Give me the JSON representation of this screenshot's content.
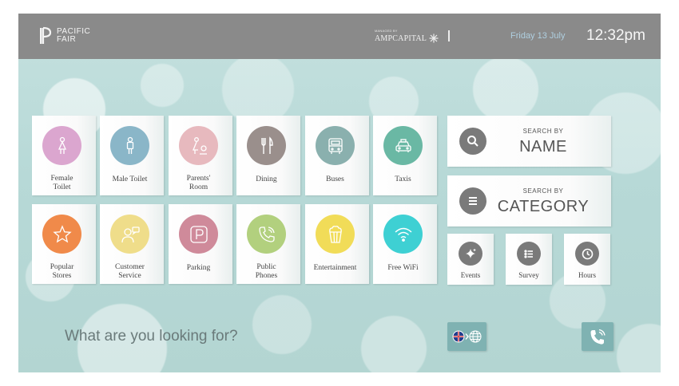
{
  "header": {
    "logo_line1": "PACIFIC",
    "logo_line2": "FAIR",
    "partner_small": "MANAGED BY",
    "partner_name": "AMPCAPITAL",
    "date": "Friday 13 July",
    "time": "12:32pm"
  },
  "tiles": [
    {
      "label": "Female\nToilet",
      "color": "#dba6cf",
      "icon": "female-icon"
    },
    {
      "label": "Male Toilet",
      "color": "#8ab6c8",
      "icon": "male-icon"
    },
    {
      "label": "Parents'\nRoom",
      "color": "#e7b9be",
      "icon": "parents-room-icon"
    },
    {
      "label": "Dining",
      "color": "#9a8f8c",
      "icon": "dining-icon"
    },
    {
      "label": "Buses",
      "color": "#8ab0ae",
      "icon": "bus-icon"
    },
    {
      "label": "Taxis",
      "color": "#6ab8a4",
      "icon": "taxi-icon"
    },
    {
      "label": "Popular\nStores",
      "color": "#f08a4a",
      "icon": "star-icon"
    },
    {
      "label": "Customer\nService",
      "color": "#efdd8a",
      "icon": "customer-service-icon"
    },
    {
      "label": "Parking",
      "color": "#cf8a9a",
      "icon": "parking-icon"
    },
    {
      "label": "Public\nPhones",
      "color": "#b2d07e",
      "icon": "phone-icon"
    },
    {
      "label": "Entertainment",
      "color": "#f1dc58",
      "icon": "popcorn-icon"
    },
    {
      "label": "Free WiFi",
      "color": "#3ed0d3",
      "icon": "wifi-icon"
    }
  ],
  "search": {
    "by_label": "SEARCH BY",
    "name_label": "NAME",
    "category_label": "CATEGORY"
  },
  "mini_buttons": [
    {
      "label": "Events",
      "icon": "sparkle-icon"
    },
    {
      "label": "Survey",
      "icon": "list-icon"
    },
    {
      "label": "Hours",
      "icon": "clock-icon"
    }
  ],
  "footer": {
    "question": "What are you looking for?",
    "language_icon": "language-switch-icon",
    "call_icon": "call-icon"
  },
  "colors": {
    "header_bg": "#8a8a8a",
    "accent_button": "#7fb2b2",
    "dark_icon": "#7a7a7a"
  }
}
